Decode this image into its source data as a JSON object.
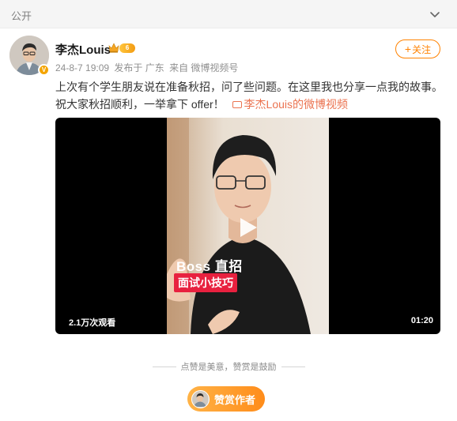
{
  "topbar": {
    "visibility_label": "公开",
    "collapse_icon": "chevron-down-icon"
  },
  "author": {
    "name": "李杰Louis",
    "verified_badge": "V",
    "member_icon": "crown-icon",
    "member_level": "6"
  },
  "meta": {
    "date": "24-8-7 19:09",
    "location": "发布于 广东",
    "source": "来自 微博视频号"
  },
  "follow_button": {
    "plus": "+",
    "label": "关注"
  },
  "post": {
    "text": "上次有个学生朋友说在准备秋招，问了些问题。在这里我也分享一点我的故事。祝大家秋招顺利，一举拿下 offer！",
    "video_link_icon": "tv-icon",
    "video_link": "李杰Louis的微博视频"
  },
  "video": {
    "overlay_title": "Boss 直招",
    "overlay_subtitle": "面试小技巧",
    "views": "2.1万次观看",
    "duration": "01:20",
    "play_icon": "play-icon"
  },
  "tip": "点赞是美意，赞赏是鼓励",
  "reward_button": {
    "label": "赞赏作者"
  },
  "colors": {
    "accent": "#ff8200",
    "link": "#eb7350",
    "overlay_red": "#e8213f"
  }
}
